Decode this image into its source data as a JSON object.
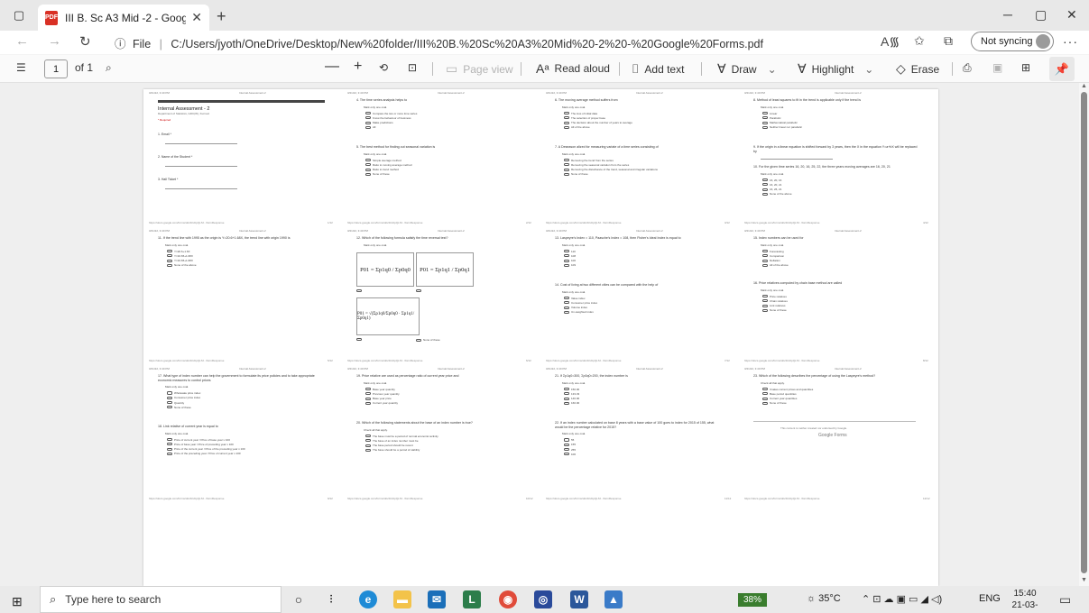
{
  "browser": {
    "tab_title": "III B. Sc A3 Mid -2 - Google Form",
    "tab_close": "✕",
    "new_tab": "+",
    "address": {
      "info_label": "File",
      "path": "C:/Users/jyoth/OneDrive/Desktop/New%20folder/III%20B.%20Sc%20A3%20Mid%20-2%20-%20Google%20Forms.pdf"
    },
    "profile_label": "Not syncing",
    "window_controls": [
      "─",
      "▢",
      "✕"
    ]
  },
  "pdf_toolbar": {
    "page_current": "1",
    "page_total": "of 1",
    "page_view": "Page view",
    "read_aloud": "Read aloud",
    "add_text": "Add text",
    "draw": "Draw",
    "highlight": "Highlight",
    "erase": "Erase"
  },
  "document": {
    "mini_header_left": "3/21/22, 3:40 PM",
    "mini_header_center": "Internal Assessment-2",
    "mini_footer": "https://docs.google.com/forms/d/e/1FAIpQLSf.../formResponse",
    "page1": {
      "title": "Internal Assessment - 2",
      "subtitle": "Department of Statistics, GDC(W), Kurnool",
      "required": "* Required",
      "fields": [
        "1.  Email *",
        "2.  Name of the Student *",
        "3.  Hall Ticket *"
      ]
    },
    "page2": {
      "q4": "4.  The time series analysis helps to",
      "q4_opts": [
        "Compare the two or more time series",
        "Know the behaviour of business",
        "Make predictions",
        "All"
      ],
      "q5": "5.  The best method for finding out seasonal variation is",
      "q5_opts": [
        "Simple average method",
        "Ratio to moving average method",
        "Ratio to trend method",
        "None of these"
      ]
    },
    "page3": {
      "q6": "6.  The moving average method suffers from",
      "q6_opts": [
        "The loss of initial data",
        "The selection of proper base",
        "The decision about the number of years to average",
        "All of the above"
      ],
      "q7": "7.  A Deseason alized for measuring variate of a time series consisting of",
      "q7_opts": [
        "Removing the trend from the series",
        "Removing the seasonal variation from the series",
        "Removing the disturbance of the trend, seasonal and irregular variations",
        "None of these"
      ]
    },
    "page4": {
      "q8": "8.  Method of least squares to fit in the trend is applicable only if the trend is",
      "q8_opts": [
        "Linear",
        "Parabolic",
        "Mathematical parabolic",
        "Neither linear nor parabolic"
      ],
      "q9": "9.  If the origin in a linear equation is shifted forward by 3 years, then the X in the equation Y=a+bX will be replaced by",
      "q10": "10.  For the given time series 16, 20, 16, 25, 22, the three years moving averages are 16, 20, 21",
      "q10_opts": [
        "16, 20, 16",
        "16, 20, 21",
        "16, 26, 21",
        "None of the above"
      ]
    },
    "page5": {
      "q11": "11.  If the trend line with 1995 as the origin is Y=20.6+1.68X, the trend line with origin 1990 is",
      "q11_opts": [
        "Y=20.6+1.6X",
        "Y=16.65+1.68X",
        "Y=16.65+1.68X",
        "None of the above"
      ]
    },
    "page6": {
      "q12": "12.  Which of the following formula satisfy the time reversal test?",
      "formula_1": "P01 = Σp1q0 / Σp0q0",
      "formula_2": "P01 = Σp1q1 / Σp0q1",
      "formula_3": "P01 = √(Σp1q0/Σp0q0 · Σp1q1/Σp0q1)",
      "opt_none": "None of these"
    },
    "page7": {
      "q13": "13.  Laspeyre's Index = 110, Paasche's Index = 108, then Fisher's Ideal Index is equal to",
      "q13_opts": [
        "110",
        "108",
        "100",
        "109"
      ],
      "q14": "14.  Cost of living at two different cities can be compared with the help of",
      "q14_opts": [
        "Value index",
        "Consumer price index",
        "Volume index",
        "Un-weighted index"
      ]
    },
    "page8": {
      "q15": "15.  Index numbers can be used for",
      "q15_opts": [
        "Forecasting",
        "Comparison",
        "Deflation",
        "All of the above"
      ],
      "q16": "16.  Price relatives computed by chain base method are called",
      "q16_opts": [
        "Price relatives",
        "Chain relatives",
        "Link relatives",
        "None of these"
      ]
    },
    "page9": {
      "q17": "17.  What type of index number can help the government to formulate its price policies and to take appropriate economic measures to control prices",
      "q17_opts": [
        "Wholesale price index",
        "Consumer price index",
        "Quantity",
        "None of these"
      ],
      "q18": "18.  Link relative of current year is equal to",
      "q18_opts": [
        "Price of current year / Price of base year x 100",
        "Price of base year / Price of preceding year x 100",
        "Price of the current year / Price of the preceding year x 100",
        "Price of the preceding year / Price of current year x 100"
      ]
    },
    "page10": {
      "q19": "19.  Price relative are used as percentage ratio of current year price and",
      "q19_opts": [
        "Base year quantity",
        "Previous year quantity",
        "Base year price",
        "Current year quantity"
      ],
      "q20": "20.  Which of the following statements about the base of an index number is true?",
      "q20_opts": [
        "The base must be a period of normal economic activity",
        "The base of an index number must be",
        "The base period should be recent",
        "The base should be a period of stability"
      ]
    },
    "page11": {
      "q21": "21.  If Σp1q0=300, Σp0q0=200, the index number is",
      "q21_opts": [
        "150.00",
        "133.33",
        "140.00",
        "160.00"
      ],
      "q22": "22.  If an index number calculated on base 8 years with a base value of 100 goes to index for 2015 of 155, what would be the percentage relative for 2015?",
      "q22_opts": [
        "55",
        "155",
        "255",
        "100"
      ]
    },
    "page12": {
      "q23": "23.  Which of the following describes the percentage of using the Laspeyre's method?",
      "q23_opts": [
        "It takes current prices and quantities",
        "Base period quantities",
        "Current year quantities",
        "None of these"
      ],
      "footer_note": "This content is neither created nor endorsed by Google.",
      "logo": "Google Forms"
    }
  },
  "taskbar": {
    "search_placeholder": "Type here to search",
    "battery": "38%",
    "weather": "35°C",
    "language": "ENG",
    "time": "15:40",
    "date": "21-03-2022"
  }
}
